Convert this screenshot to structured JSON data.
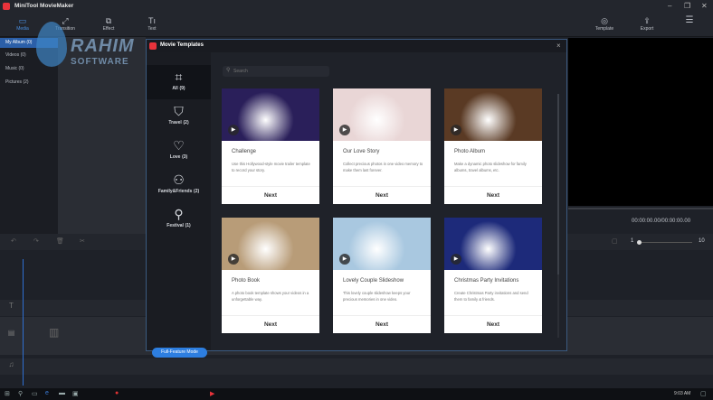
{
  "app": {
    "title": "MiniTool MovieMaker"
  },
  "toolbar": {
    "media": "Media",
    "transition": "Transition",
    "effect": "Effect",
    "text": "Text",
    "template": "Template",
    "export": "Export"
  },
  "media_panel": {
    "items": [
      {
        "label": "My Album (0)"
      },
      {
        "label": "Videos (0)"
      },
      {
        "label": "Music (0)"
      },
      {
        "label": "Pictures (2)"
      }
    ]
  },
  "watermark": {
    "line1": "RAHIM",
    "line2": "SOFTWARE"
  },
  "preview": {
    "timecode": "00:00:00.00/00:00:00.00"
  },
  "timeline": {
    "zoom_min": "1",
    "zoom_max": "10"
  },
  "modal": {
    "title": "Movie Templates",
    "search_placeholder": "Search",
    "full_feature_label": "Full-Feature Mode",
    "categories": [
      {
        "label": "All",
        "count": "(9)",
        "icon": "grid-icon"
      },
      {
        "label": "Travel",
        "count": "(2)",
        "icon": "luggage-icon"
      },
      {
        "label": "Love",
        "count": "(3)",
        "icon": "hearts-icon"
      },
      {
        "label": "Family&Friends",
        "count": "(2)",
        "icon": "people-icon"
      },
      {
        "label": "Festival",
        "count": "(1)",
        "icon": "balloons-icon"
      }
    ],
    "templates": [
      {
        "title": "Challenge",
        "desc": "Use this Hollywood-style movie trailer template to record your story.",
        "next": "Next",
        "bg": "#2a1f5a"
      },
      {
        "title": "Our Love Story",
        "desc": "Collect precious photos in one video memory to make them last forever.",
        "next": "Next",
        "bg": "#e9d6d6"
      },
      {
        "title": "Photo Album",
        "desc": "Make a dynamic photo slideshow for family albums, travel albums, etc.",
        "next": "Next",
        "bg": "#5a3a24"
      },
      {
        "title": "Photo Book",
        "desc": "A photo book template shows your videos in a unforgettable way.",
        "next": "Next",
        "bg": "#b89c78"
      },
      {
        "title": "Lovely Couple Slideshow",
        "desc": "This lovely couple slideshow keeps your precious memories in one video.",
        "next": "Next",
        "bg": "#a9c8e0"
      },
      {
        "title": "Christmas Party Invitations",
        "desc": "Create Christmas Party invitations and send them to family & friends.",
        "next": "Next",
        "bg": "#1d2a7a"
      }
    ]
  },
  "taskbar": {
    "time": "9:03 AM"
  }
}
